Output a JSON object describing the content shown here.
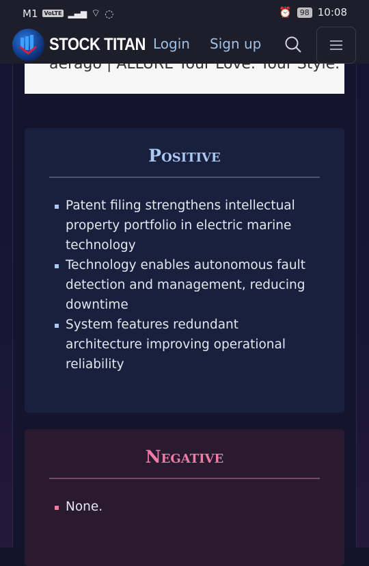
{
  "status_bar": {
    "carrier": "M1",
    "volte": "VoLTE",
    "battery": "98",
    "time": "10:08"
  },
  "nav": {
    "brand": "STOCK TITAN",
    "login": "Login",
    "signup": "Sign up"
  },
  "ad": {
    "text": "aerago  |  ALLURE      Your Love. Your Style. Your"
  },
  "positive": {
    "title": "Positive",
    "items": [
      "Patent filing strengthens intellectual property portfolio in electric marine technology",
      "Technology enables autonomous fault detection and management, reducing downtime",
      "System features redundant architecture improving operational reliability"
    ]
  },
  "negative": {
    "title": "Negative",
    "items": [
      "None."
    ]
  },
  "colors": {
    "positive": "#a9c8f2",
    "negative": "#f07ca4",
    "link": "#9fc2ea"
  }
}
